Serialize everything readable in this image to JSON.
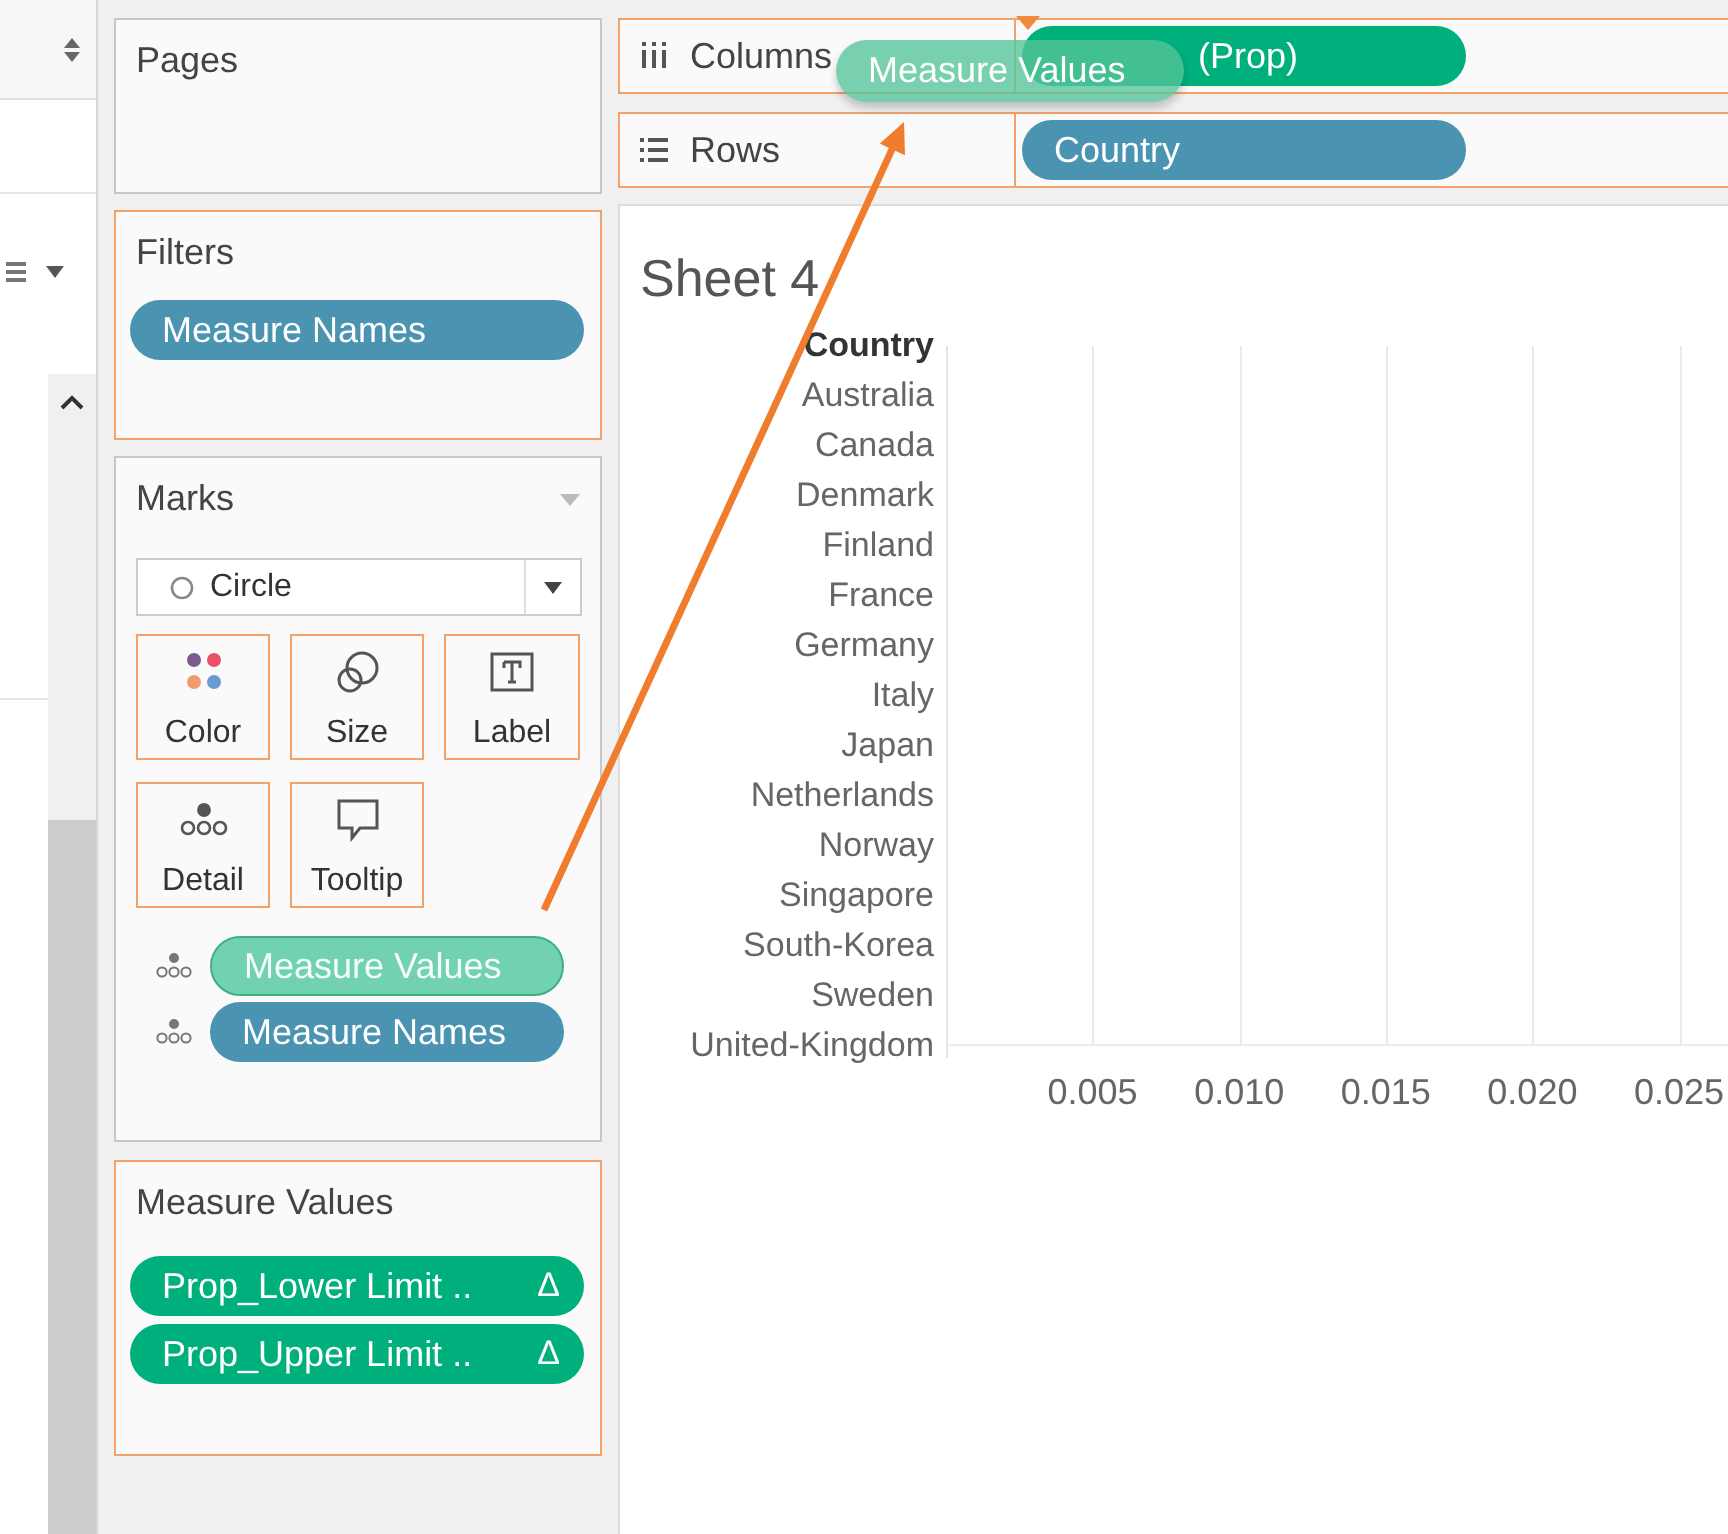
{
  "cards": {
    "pages": {
      "title": "Pages"
    },
    "filters": {
      "title": "Filters",
      "pills": [
        {
          "label": "Measure Names",
          "color": "#4a94b2"
        }
      ]
    },
    "marks": {
      "title": "Marks",
      "mark_type": "Circle",
      "buttons": [
        {
          "kind": "color",
          "label": "Color"
        },
        {
          "kind": "size",
          "label": "Size"
        },
        {
          "kind": "label",
          "label": "Label"
        },
        {
          "kind": "detail",
          "label": "Detail"
        },
        {
          "kind": "tooltip",
          "label": "Tooltip"
        }
      ],
      "pills": [
        {
          "label": "Measure Values",
          "color": "#72d1b1"
        },
        {
          "label": "Measure Names",
          "color": "#4a94b2"
        }
      ]
    },
    "measure_values": {
      "title": "Measure Values",
      "pills": [
        {
          "label": "Prop_Lower Limit ..",
          "marker": "Δ",
          "color": "#00b07c"
        },
        {
          "label": "Prop_Upper Limit ..",
          "marker": "Δ",
          "color": "#00b07c"
        }
      ]
    }
  },
  "shelves": [
    {
      "kind": "columns",
      "label": "Columns",
      "pills": [
        {
          "label": "(Prop)",
          "color": "#00b07c"
        }
      ]
    },
    {
      "kind": "rows",
      "label": "Rows",
      "pills": [
        {
          "label": "Country",
          "color": "#4a94b2"
        }
      ]
    }
  ],
  "drag_pill": {
    "label": "Measure Values"
  },
  "sheet": {
    "title": "Sheet 4",
    "row_header": "Country",
    "rows": [
      "Australia",
      "Canada",
      "Denmark",
      "Finland",
      "France",
      "Germany",
      "Italy",
      "Japan",
      "Netherlands",
      "Norway",
      "Singapore",
      "South-Korea",
      "Sweden",
      "United-Kingdom"
    ],
    "axis_ticks": [
      "0.005",
      "0.010",
      "0.015",
      "0.020",
      "0.025"
    ]
  }
}
